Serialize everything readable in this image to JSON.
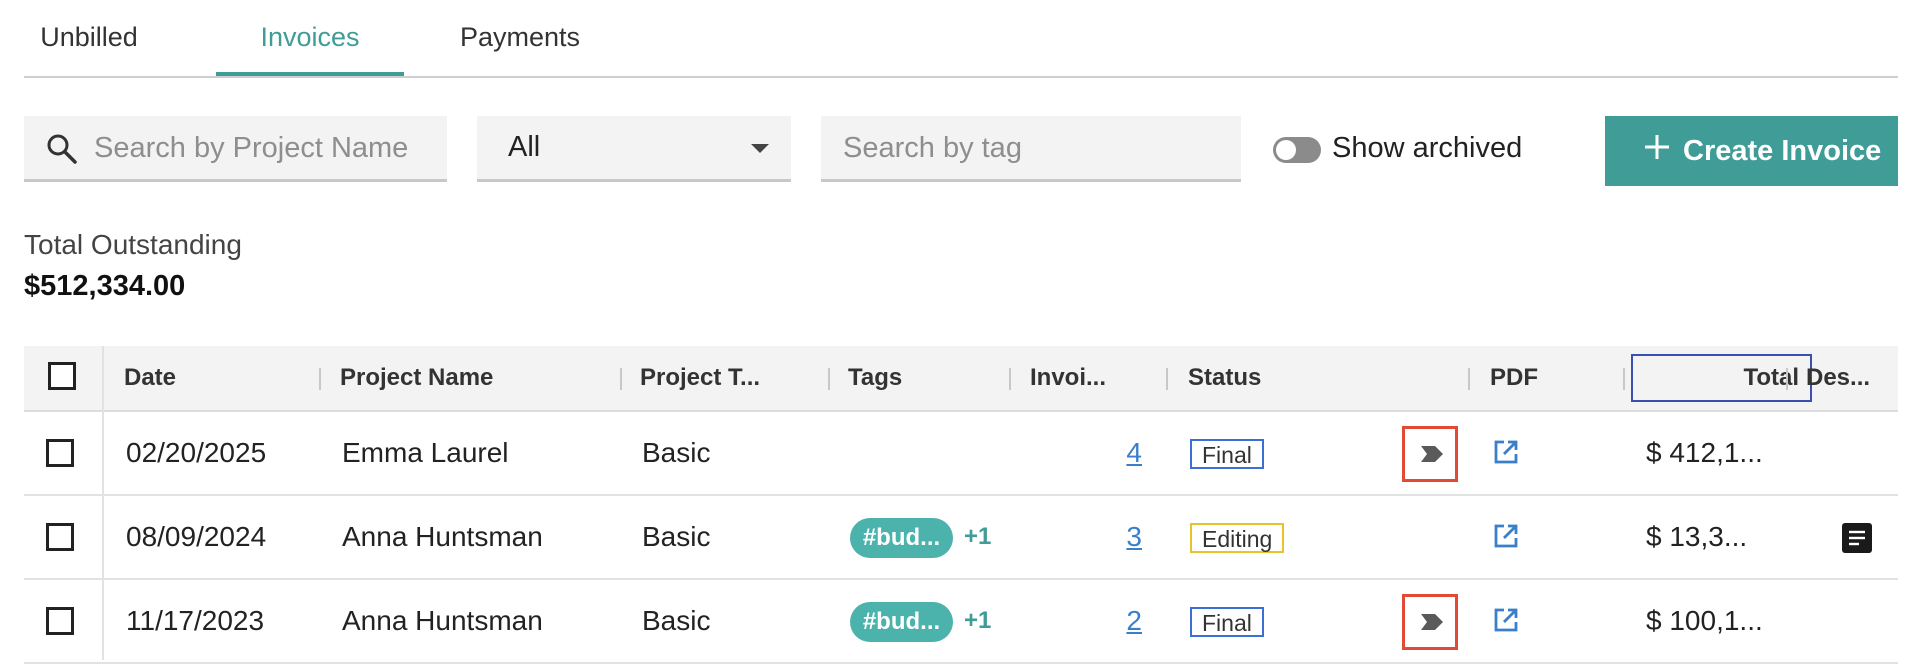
{
  "tabs": [
    {
      "label": "Unbilled",
      "active": false
    },
    {
      "label": "Invoices",
      "active": true
    },
    {
      "label": "Payments",
      "active": false
    }
  ],
  "toolbar": {
    "project_search_placeholder": "Search by Project Name",
    "filter_value": "All",
    "tag_search_placeholder": "Search by tag",
    "show_archived_label": "Show archived",
    "show_archived_on": false,
    "create_label": "Create Invoice"
  },
  "summary": {
    "label": "Total Outstanding",
    "value": "$512,334.00"
  },
  "table": {
    "headers": {
      "date": "Date",
      "project_name": "Project Name",
      "project_type": "Project T...",
      "tags": "Tags",
      "invoice": "Invoi...",
      "status": "Status",
      "pdf": "PDF",
      "total": "Total",
      "description": "Des..."
    },
    "rows": [
      {
        "date": "02/20/2025",
        "project_name": "Emma Laurel",
        "project_type": "Basic",
        "tag": "",
        "tag_more": "",
        "invoice": "4",
        "status": "Final",
        "total": "$ 412,1...",
        "has_send": true,
        "has_note": false
      },
      {
        "date": "08/09/2024",
        "project_name": "Anna Huntsman",
        "project_type": "Basic",
        "tag": "#bud...",
        "tag_more": "+1",
        "invoice": "3",
        "status": "Editing",
        "total": "$ 13,3...",
        "has_send": false,
        "has_note": true
      },
      {
        "date": "11/17/2023",
        "project_name": "Anna Huntsman",
        "project_type": "Basic",
        "tag": "#bud...",
        "tag_more": "+1",
        "invoice": "2",
        "status": "Final",
        "total": "$ 100,1...",
        "has_send": true,
        "has_note": false
      }
    ]
  },
  "colors": {
    "accent": "#3f9c97",
    "tag_bg": "#4bb2ac",
    "link": "#3a7fc9",
    "final_border": "#3b6fd4",
    "editing_border": "#e8c42a",
    "send_highlight": "#e34a35"
  },
  "icons": {
    "search": "search-icon",
    "dropdown": "caret-down-icon",
    "create": "plus-icon",
    "send": "send-icon",
    "pdf": "open-external-icon",
    "description": "note-icon"
  }
}
